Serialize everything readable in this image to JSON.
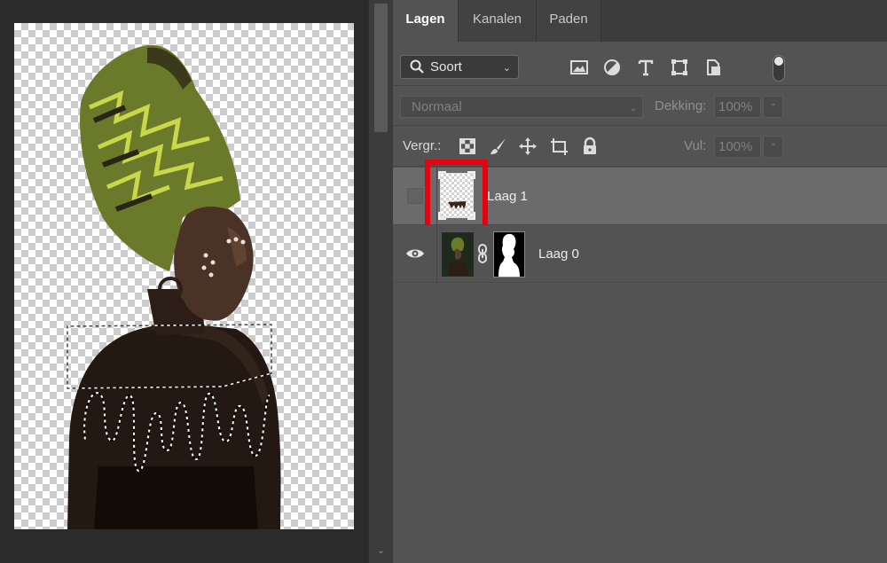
{
  "tabs": [
    {
      "label": "Lagen",
      "active": true
    },
    {
      "label": "Kanalen",
      "active": false
    },
    {
      "label": "Paden",
      "active": false
    }
  ],
  "filter": {
    "kind_label": "Soort",
    "filter_icons": [
      "image-filter-icon",
      "adjustment-filter-icon",
      "type-filter-icon",
      "shape-filter-icon",
      "smart-object-filter-icon"
    ]
  },
  "blend": {
    "mode": "Normaal",
    "opacity_label": "Dekking:",
    "opacity_value": "100%"
  },
  "lock": {
    "label": "Vergr.:",
    "lock_icons": [
      "lock-transparent-pixels-icon",
      "lock-image-pixels-icon",
      "lock-position-icon",
      "lock-artboard-icon",
      "lock-all-icon"
    ],
    "fill_label": "Vul:",
    "fill_value": "100%"
  },
  "layers": [
    {
      "name": "Laag 1",
      "visible": false,
      "selected": true,
      "highlighted": true
    },
    {
      "name": "Laag 0",
      "visible": true,
      "selected": false,
      "has_mask": true
    }
  ],
  "colors": {
    "highlight": "#e8000b",
    "panel_bg": "#535353",
    "selected_row": "#6b6b6b"
  }
}
